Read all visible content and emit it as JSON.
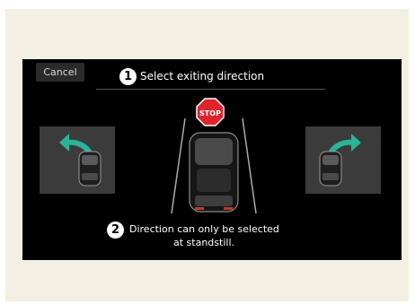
{
  "screen": {
    "cancel_label": "Cancel",
    "step1_number": "1",
    "title": "Select exiting direction",
    "stop_sign_text": "STOP",
    "step2_number": "2",
    "note_line1": "Direction can only be selected",
    "note_line2": "at standstill."
  },
  "colors": {
    "arrow": "#2bb39a",
    "stop_sign": "#e0242c",
    "panel": "#3b3b3b",
    "frame": "#f3efe3"
  },
  "icons": [
    "stop-sign-icon",
    "left-exit-arrow-icon",
    "right-exit-arrow-icon",
    "car-icon"
  ]
}
